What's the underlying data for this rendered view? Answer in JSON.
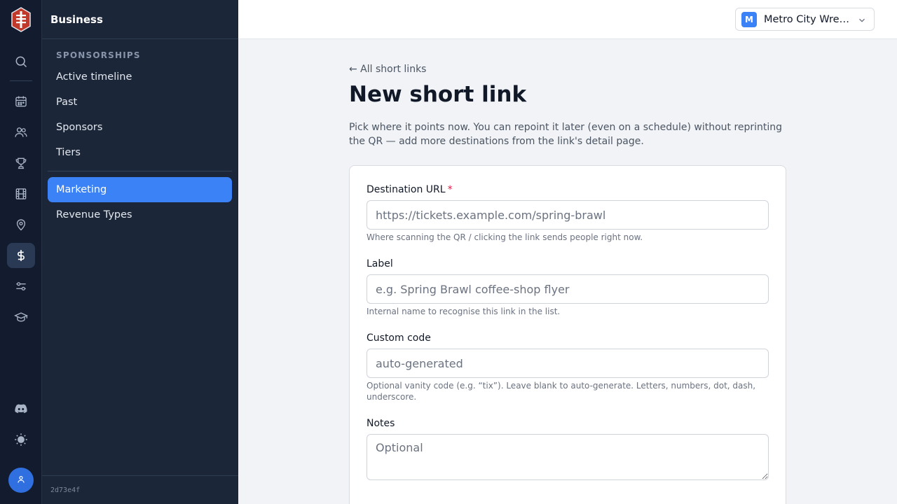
{
  "app": {
    "name": "Business",
    "build": "2d73e4f"
  },
  "rail": {
    "icons": [
      "logo-icon",
      "search-icon",
      "calendar-icon",
      "people-icon",
      "trophy-icon",
      "film-icon",
      "map-pin-icon",
      "dollar-icon",
      "sliders-icon",
      "graduation-cap-icon",
      "discord-icon",
      "sun-icon",
      "user-icon"
    ],
    "active": "dollar-icon"
  },
  "sidebar": {
    "section_title": "SPONSORSHIPS",
    "items": [
      {
        "label": "Active timeline"
      },
      {
        "label": "Past"
      },
      {
        "label": "Sponsors"
      },
      {
        "label": "Tiers"
      }
    ],
    "items2": [
      {
        "label": "Marketing",
        "active": true
      },
      {
        "label": "Revenue Types"
      }
    ]
  },
  "org_switcher": {
    "initial": "M",
    "name": "Metro City Wrestling"
  },
  "page": {
    "back_link": "← All short links",
    "title": "New short link",
    "description": "Pick where it points now. You can repoint it later (even on a schedule) without reprinting the QR — add more destinations from the link's detail page."
  },
  "form": {
    "destination": {
      "label": "Destination URL",
      "required_mark": "*",
      "placeholder": "https://tickets.example.com/spring-brawl",
      "value": "",
      "help": "Where scanning the QR / clicking the link sends people right now."
    },
    "label_field": {
      "label": "Label",
      "placeholder": "e.g. Spring Brawl coffee-shop flyer",
      "value": "",
      "help": "Internal name to recognise this link in the list."
    },
    "custom_code": {
      "label": "Custom code",
      "placeholder": "auto-generated",
      "value": "",
      "help": "Optional vanity code (e.g. “tix”). Leave blank to auto-generate. Letters, numbers, dot, dash, underscore."
    },
    "notes": {
      "label": "Notes",
      "placeholder": "Optional",
      "value": ""
    }
  },
  "colors": {
    "accent": "#3b82f6",
    "rail_bg": "#131c2e",
    "sidebar_bg": "#1b2638",
    "required": "#e11d48"
  }
}
